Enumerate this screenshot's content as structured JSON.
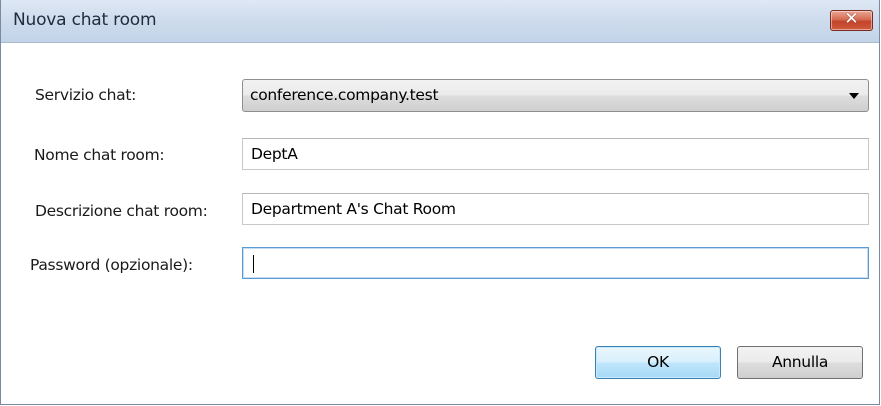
{
  "window": {
    "title": "Nuova chat room",
    "close_glyph": "✕"
  },
  "form": {
    "service_label": "Servizio chat:",
    "service_value": "conference.company.test",
    "name_label": "Nome chat room:",
    "name_value": "DeptA",
    "description_label": "Descrizione chat room:",
    "description_value": "Department A's Chat Room",
    "password_label": "Password (opzionale):",
    "password_value": ""
  },
  "buttons": {
    "ok_label": "OK",
    "cancel_label": "Annulla"
  },
  "icons": {
    "close": "close-icon",
    "dropdown": "chevron-down-icon"
  },
  "colors": {
    "close_button": "#c2432b",
    "default_button_border": "#3c7fb1",
    "focused_field_border": "#5b9bd5"
  }
}
